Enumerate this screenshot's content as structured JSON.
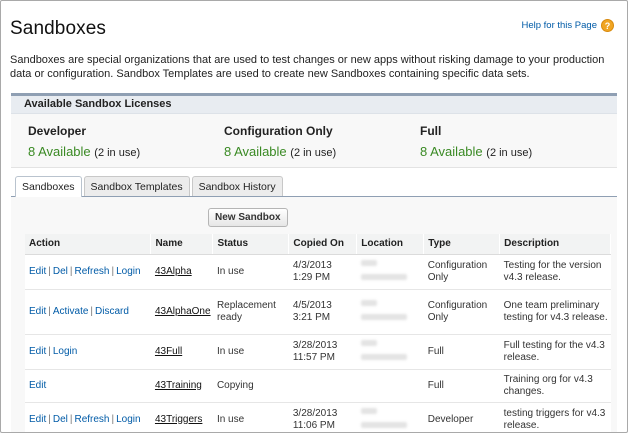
{
  "page": {
    "title": "Sandboxes",
    "help_label": "Help for this Page",
    "help_icon": "question-mark-icon",
    "intro": "Sandboxes are special organizations that are used to test changes or new apps without risking damage to your production data or configuration. Sandbox Templates are used to create new Sandboxes containing specific data sets."
  },
  "licenses": {
    "header": "Available Sandbox Licenses",
    "items": [
      {
        "name": "Developer",
        "available": "8 Available",
        "in_use": "(2 in use)"
      },
      {
        "name": "Configuration Only",
        "available": "8 Available",
        "in_use": "(2 in use)"
      },
      {
        "name": "Full",
        "available": "8 Available",
        "in_use": "(2 in use)"
      }
    ]
  },
  "tabs": [
    {
      "label": "Sandboxes",
      "active": true
    },
    {
      "label": "Sandbox Templates",
      "active": false
    },
    {
      "label": "Sandbox History",
      "active": false
    }
  ],
  "new_button": "New Sandbox",
  "table": {
    "columns": [
      "Action",
      "Name",
      "Status",
      "Copied On",
      "Location",
      "Type",
      "Description"
    ],
    "rows": [
      {
        "actions": [
          "Edit",
          "Del",
          "Refresh",
          "Login"
        ],
        "name": "43Alpha",
        "status": "In use",
        "copied_date": "4/3/2013",
        "copied_time": "1:29 PM",
        "type": "Configuration Only",
        "description": "Testing for the version v4.3 release."
      },
      {
        "actions": [
          "Edit",
          "Activate",
          "Discard"
        ],
        "name": "43AlphaOne",
        "status": "Replacement ready",
        "copied_date": "4/5/2013",
        "copied_time": "3:21 PM",
        "type": "Configuration Only",
        "description": "One team preliminary testing for v4.3 release."
      },
      {
        "actions": [
          "Edit",
          "Login"
        ],
        "name": "43Full",
        "status": "In use",
        "copied_date": "3/28/2013",
        "copied_time": "11:57 PM",
        "type": "Full",
        "description": "Full testing for the v4.3 release."
      },
      {
        "actions": [
          "Edit"
        ],
        "name": "43Training",
        "status": "Copying",
        "copied_date": "",
        "copied_time": "",
        "type": "Full",
        "description": "Training org for v4.3 changes."
      },
      {
        "actions": [
          "Edit",
          "Del",
          "Refresh",
          "Login"
        ],
        "name": "43Triggers",
        "status": "In use",
        "copied_date": "3/28/2013",
        "copied_time": "11:06 PM",
        "type": "Developer",
        "description": "testing triggers for v4.3 release."
      }
    ]
  },
  "colors": {
    "link": "#015ba7",
    "available": "#3a8a24",
    "accent_border": "#8f9fb3",
    "help_icon": "#f0a523"
  }
}
